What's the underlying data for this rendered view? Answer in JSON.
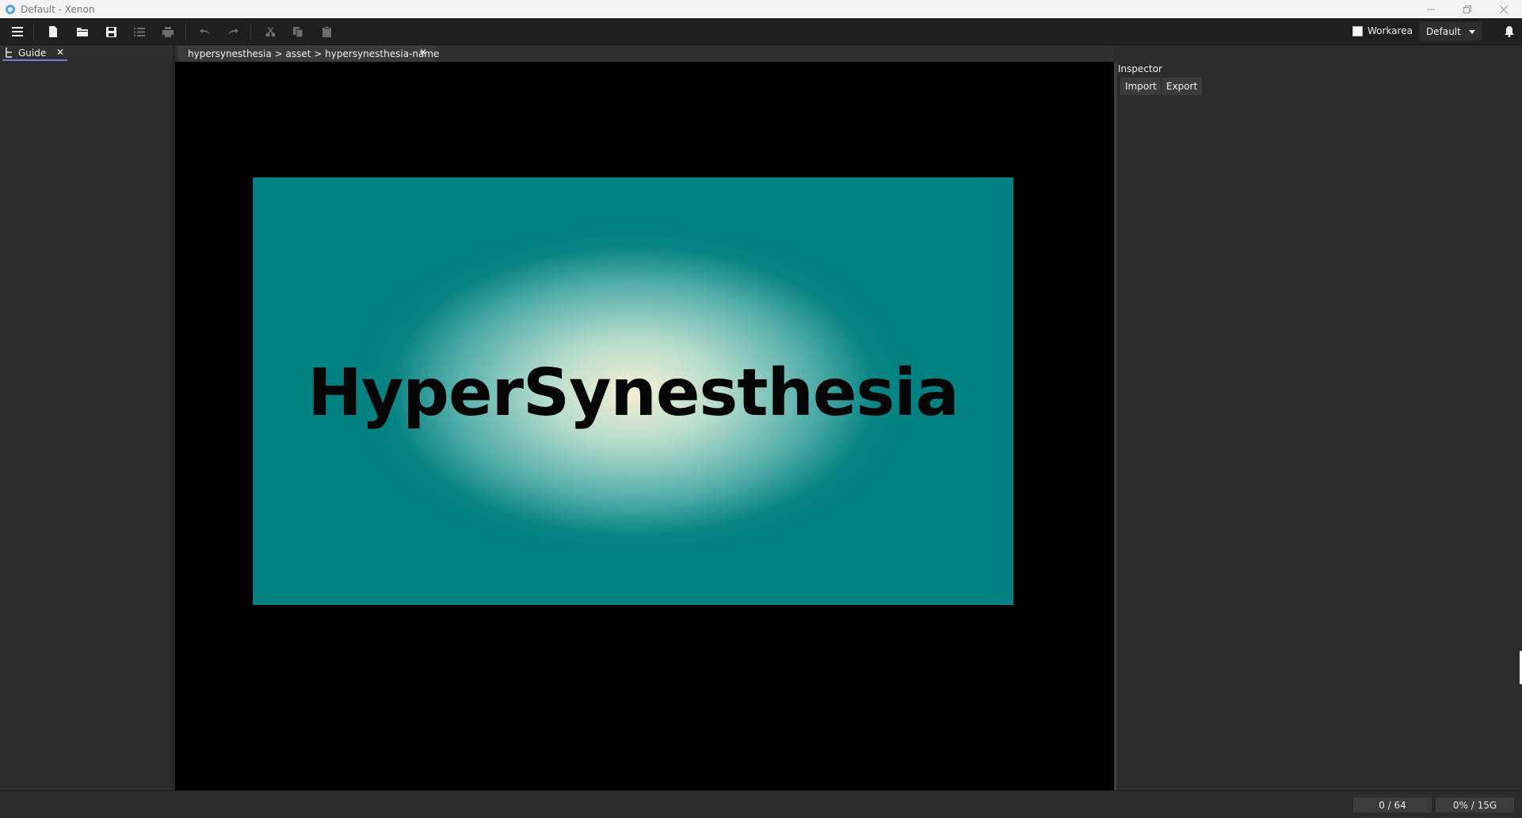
{
  "window": {
    "title": "Default - Xenon",
    "controls": [
      "minimize-icon",
      "restore-icon",
      "close-icon"
    ]
  },
  "toolbar": {
    "buttons": [
      {
        "name": "menu-button",
        "icon": "hamburger-icon",
        "enabled": true
      },
      {
        "name": "new-file-button",
        "icon": "new-file-icon",
        "enabled": true
      },
      {
        "name": "open-folder-button",
        "icon": "folder-icon",
        "enabled": true
      },
      {
        "name": "save-button",
        "icon": "save-icon",
        "enabled": true
      },
      {
        "name": "list-button",
        "icon": "list-icon",
        "enabled": false
      },
      {
        "name": "print-button",
        "icon": "print-icon",
        "enabled": false
      },
      {
        "name": "undo-button",
        "icon": "undo-icon",
        "enabled": false
      },
      {
        "name": "redo-button",
        "icon": "redo-icon",
        "enabled": false
      },
      {
        "name": "cut-button",
        "icon": "cut-icon",
        "enabled": false
      },
      {
        "name": "copy-button",
        "icon": "copy-icon",
        "enabled": false
      },
      {
        "name": "paste-button",
        "icon": "paste-icon",
        "enabled": false
      }
    ],
    "workarea_label": "Workarea",
    "workarea_checked": false,
    "layout_value": "Default"
  },
  "guide_panel": {
    "tab_label": "Guide",
    "close_glyph": "✕"
  },
  "document": {
    "tab_label": "hypersynesthesia > asset > hypersynesthesia-name",
    "close_glyph": "✕",
    "artboard_text": "HyperSynesthesia"
  },
  "inspector": {
    "header": "Inspector",
    "import_label": "Import",
    "export_label": "Export"
  },
  "statusbar": {
    "count": "0 / 64",
    "memory": "0% / 15G"
  },
  "colors": {
    "accent": "#6b7cd8",
    "artboard_edge": "#008080",
    "artboard_center": "#f6efd3",
    "viewport_bg": "#000000",
    "panel_bg": "#2b2b2b"
  }
}
